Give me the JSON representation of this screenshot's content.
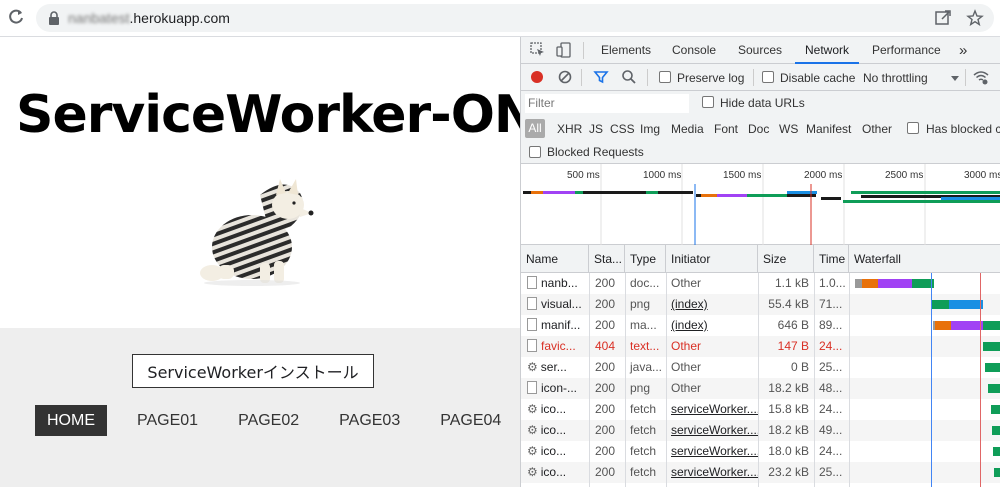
{
  "browser": {
    "url_prefix": "nanbatest",
    "url_suffix": ".herokuapp.com"
  },
  "page": {
    "title": "ServiceWorker-ON",
    "install_button": "ServiceWorkerインストール",
    "nav": [
      "HOME",
      "PAGE01",
      "PAGE02",
      "PAGE03",
      "PAGE04"
    ]
  },
  "devtools": {
    "tabs": [
      "Elements",
      "Console",
      "Sources",
      "Network",
      "Performance"
    ],
    "more_tabs": "»",
    "active_tab": "Network",
    "toolbar": {
      "preserve_log": "Preserve log",
      "disable_cache": "Disable cache",
      "throttling": "No throttling"
    },
    "filter": {
      "placeholder": "Filter",
      "hide_data_urls": "Hide data URLs",
      "types": [
        "All",
        "XHR",
        "JS",
        "CSS",
        "Img",
        "Media",
        "Font",
        "Doc",
        "WS",
        "Manifest",
        "Other"
      ],
      "has_blocked_cookies": "Has blocked c",
      "blocked_requests": "Blocked Requests"
    },
    "overview_ticks": [
      "500 ms",
      "1000 ms",
      "1500 ms",
      "2000 ms",
      "2500 ms",
      "3000 ms"
    ],
    "columns": [
      "Name",
      "Sta...",
      "Type",
      "Initiator",
      "Size",
      "Time",
      "Waterfall"
    ],
    "rows": [
      {
        "name": "nanb...",
        "status": "200",
        "type": "doc...",
        "initiator": "Other",
        "size": "1.1 kB",
        "time": "1.0...",
        "icon": "file",
        "error": false,
        "link": false
      },
      {
        "name": "visual...",
        "status": "200",
        "type": "png",
        "initiator": "(index)",
        "size": "55.4 kB",
        "time": "71...",
        "icon": "file",
        "error": false,
        "link": true
      },
      {
        "name": "manif...",
        "status": "200",
        "type": "ma...",
        "initiator": "(index)",
        "size": "646 B",
        "time": "89...",
        "icon": "file",
        "error": false,
        "link": true
      },
      {
        "name": "favic...",
        "status": "404",
        "type": "text...",
        "initiator": "Other",
        "size": "147 B",
        "time": "24...",
        "icon": "file",
        "error": true,
        "link": false
      },
      {
        "name": "ser...",
        "status": "200",
        "type": "java...",
        "initiator": "Other",
        "size": "0 B",
        "time": "25...",
        "icon": "gear",
        "error": false,
        "link": false
      },
      {
        "name": "icon-...",
        "status": "200",
        "type": "png",
        "initiator": "Other",
        "size": "18.2 kB",
        "time": "48...",
        "icon": "file",
        "error": false,
        "link": false
      },
      {
        "name": "ico...",
        "status": "200",
        "type": "fetch",
        "initiator": "serviceWorker....",
        "size": "15.8 kB",
        "time": "24...",
        "icon": "gear",
        "error": false,
        "link": true
      },
      {
        "name": "ico...",
        "status": "200",
        "type": "fetch",
        "initiator": "serviceWorker....",
        "size": "18.2 kB",
        "time": "49...",
        "icon": "gear",
        "error": false,
        "link": true
      },
      {
        "name": "ico...",
        "status": "200",
        "type": "fetch",
        "initiator": "serviceWorker....",
        "size": "18.0 kB",
        "time": "24...",
        "icon": "gear",
        "error": false,
        "link": true
      },
      {
        "name": "ico...",
        "status": "200",
        "type": "fetch",
        "initiator": "serviceWorker....",
        "size": "23.2 kB",
        "time": "25...",
        "icon": "gear",
        "error": false,
        "link": true
      }
    ]
  },
  "colors": {
    "accent": "#1a73e8",
    "record": "#d93025",
    "error": "#d93025",
    "waiting": "#0f9d58",
    "receiving": "#1a8fe3",
    "script": "#a142f4",
    "connect": "#e8710a"
  }
}
